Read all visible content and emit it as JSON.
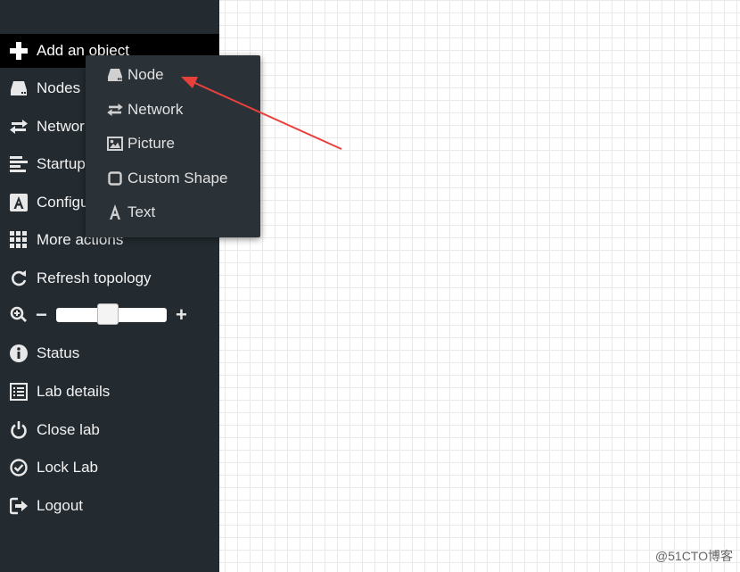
{
  "sidebar": {
    "items": [
      {
        "label": "Add an object",
        "icon": "plus-icon"
      },
      {
        "label": "Nodes",
        "icon": "server-icon"
      },
      {
        "label": "Networks",
        "icon": "exchange-icon"
      },
      {
        "label": "Startup-configs",
        "icon": "align-left-icon"
      },
      {
        "label": "Configured objects",
        "icon": "font-icon"
      },
      {
        "label": "More actions",
        "icon": "grid-icon"
      },
      {
        "label": "Refresh topology",
        "icon": "refresh-icon"
      },
      {
        "label": "Status",
        "icon": "info-icon"
      },
      {
        "label": "Lab details",
        "icon": "list-icon"
      },
      {
        "label": "Close lab",
        "icon": "power-icon"
      },
      {
        "label": "Lock Lab",
        "icon": "check-circle-icon"
      },
      {
        "label": "Logout",
        "icon": "sign-out-icon"
      }
    ],
    "zoom": {
      "minus": "−",
      "plus": "+",
      "level": 0.5
    }
  },
  "dropdown": {
    "items": [
      {
        "label": "Node",
        "icon": "server-icon"
      },
      {
        "label": "Network",
        "icon": "exchange-icon"
      },
      {
        "label": "Picture",
        "icon": "picture-icon"
      },
      {
        "label": "Custom Shape",
        "icon": "square-icon"
      },
      {
        "label": "Text",
        "icon": "font-icon"
      }
    ]
  },
  "annotation": {
    "color": "#e8413c"
  },
  "watermark": "@51CTO博客"
}
